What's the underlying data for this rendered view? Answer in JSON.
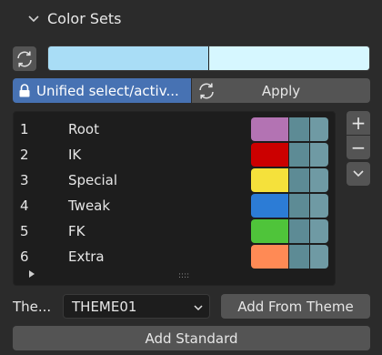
{
  "panel": {
    "title": "Color Sets"
  },
  "preview": {
    "colors": [
      "#a9ddf6",
      "#d6f7ff"
    ]
  },
  "toolbar": {
    "lock_label": "Unified select/activ...",
    "apply_label": "Apply"
  },
  "color_sets": [
    {
      "num": "1",
      "name": "Root",
      "colors": [
        "#b373b3",
        "#5d8b95",
        "#6f9aa4"
      ]
    },
    {
      "num": "2",
      "name": "IK",
      "colors": [
        "#cc0000",
        "#5d8b95",
        "#6f9aa4"
      ]
    },
    {
      "num": "3",
      "name": "Special",
      "colors": [
        "#f5e13b",
        "#5d8b95",
        "#6f9aa4"
      ]
    },
    {
      "num": "4",
      "name": "Tweak",
      "colors": [
        "#2c7cd6",
        "#5d8b95",
        "#6f9aa4"
      ]
    },
    {
      "num": "5",
      "name": "FK",
      "colors": [
        "#4fc43a",
        "#5d8b95",
        "#6f9aa4"
      ]
    },
    {
      "num": "6",
      "name": "Extra",
      "colors": [
        "#ff8a55",
        "#5d8b95",
        "#6f9aa4"
      ]
    }
  ],
  "side_buttons": {
    "add": "+",
    "remove": "−"
  },
  "theme": {
    "label": "The...",
    "value": "THEME01",
    "add_from_theme": "Add From Theme"
  },
  "add_standard": "Add Standard"
}
